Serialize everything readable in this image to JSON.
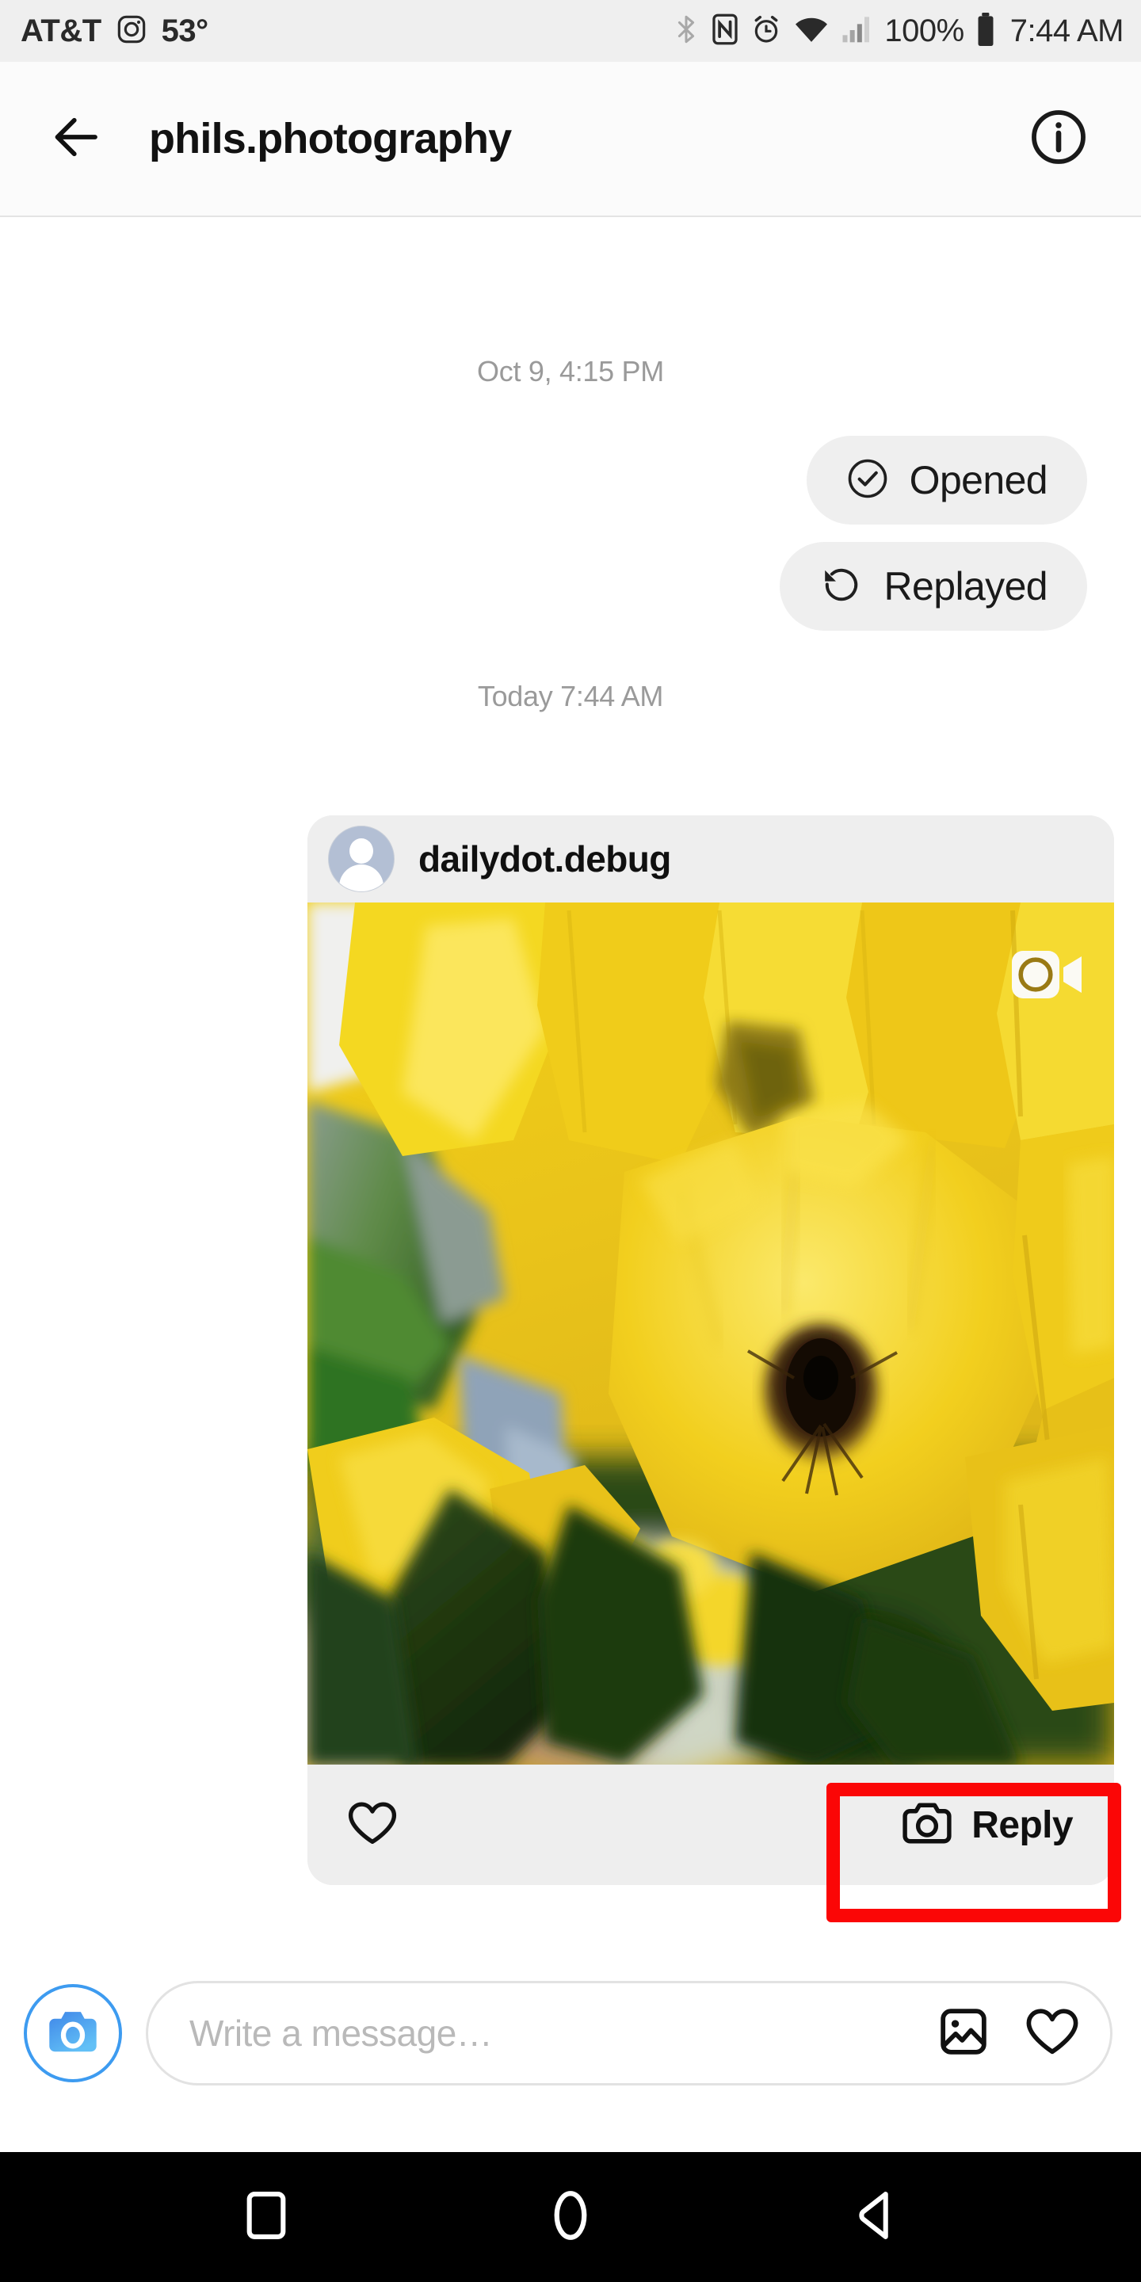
{
  "status_bar": {
    "carrier": "AT&T",
    "instagram_icon": "instagram-icon",
    "temperature": "53°",
    "bluetooth_icon": "bluetooth-icon",
    "nfc_icon": "nfc-icon",
    "alarm_icon": "alarm-clock-icon",
    "wifi_icon": "wifi-icon",
    "signal_icon": "cellular-signal-icon",
    "battery_percent": "100%",
    "battery_icon": "battery-full-icon",
    "time": "7:44 AM"
  },
  "header": {
    "back_icon": "back-arrow-icon",
    "title": "phils.photography",
    "info_icon": "info-circle-icon"
  },
  "thread": {
    "separator_1": "Oct 9, 4:15 PM",
    "separator_2": "Today 7:44 AM",
    "pills": [
      {
        "label": "Opened",
        "icon": "check-circle-icon"
      },
      {
        "label": "Replayed",
        "icon": "replay-arrow-icon"
      }
    ],
    "story_card": {
      "avatar_icon": "default-avatar-icon",
      "username": "dailydot.debug",
      "media_type_badge": "video-camera-icon",
      "media_description": "yellow trumpet flowers close-up with green leaves",
      "like_icon": "heart-outline-icon",
      "reply_icon": "camera-outline-icon",
      "reply_label": "Reply"
    }
  },
  "annotation": {
    "highlight_target": "reply-button",
    "color": "#fb0606"
  },
  "composer": {
    "camera_icon": "camera-filled-icon",
    "placeholder": "Write a message…",
    "gallery_icon": "gallery-image-icon",
    "heart_icon": "heart-outline-icon"
  },
  "navbar": {
    "recents_icon": "square-recents-icon",
    "home_icon": "circle-home-icon",
    "back_icon": "triangle-back-icon"
  },
  "colors": {
    "accent_blue": "#3d9bf0",
    "pill_gray": "#efefef",
    "card_gray": "#eeeeee",
    "annotation_red": "#fb0606"
  }
}
